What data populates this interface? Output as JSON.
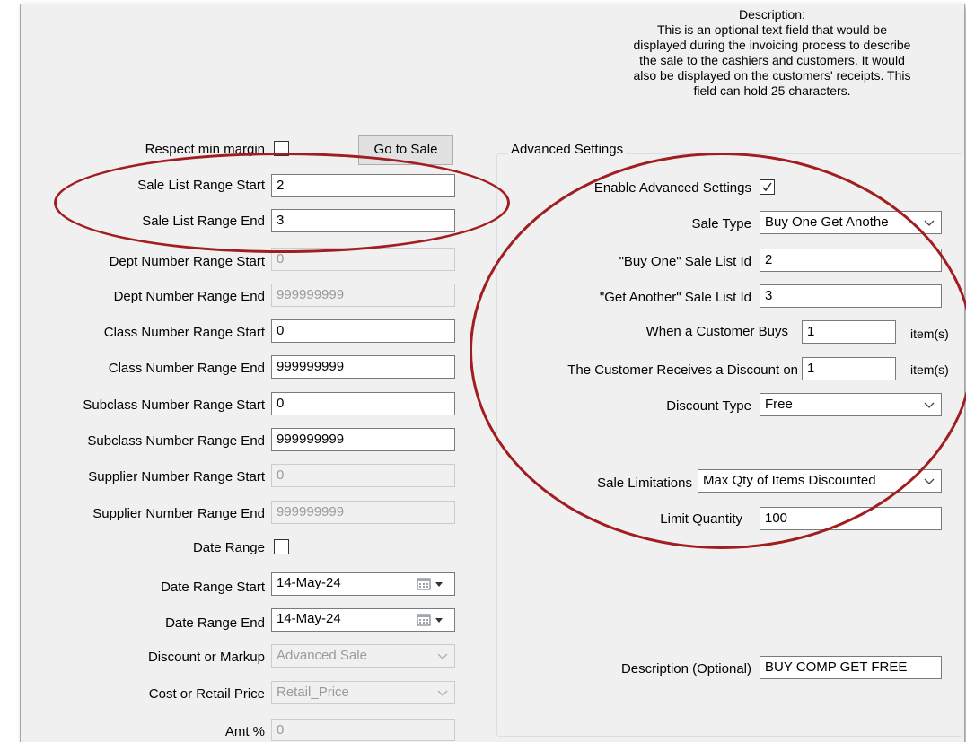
{
  "description_note": [
    "Description:",
    "This is an optional text field that would be",
    "displayed during the invoicing process to describe",
    "the sale to the cashiers and customers. It would",
    "also be displayed on the customers' receipts. This",
    "field can hold 25 characters."
  ],
  "left": {
    "respect_min_margin_label": "Respect min margin",
    "respect_min_margin_checked": false,
    "go_to_sale_label": "Go to Sale",
    "sale_list_range_start_label": "Sale List Range Start",
    "sale_list_range_start_value": "2",
    "sale_list_range_end_label": "Sale List Range End",
    "sale_list_range_end_value": "3",
    "dept_start_label": "Dept Number Range Start",
    "dept_start_value": "0",
    "dept_end_label": "Dept Number Range End",
    "dept_end_value": "999999999",
    "class_start_label": "Class Number Range Start",
    "class_start_value": "0",
    "class_end_label": "Class Number Range End",
    "class_end_value": "999999999",
    "subclass_start_label": "Subclass Number Range Start",
    "subclass_start_value": "0",
    "subclass_end_label": "Subclass Number Range End",
    "subclass_end_value": "999999999",
    "supplier_start_label": "Supplier Number Range Start",
    "supplier_start_value": "0",
    "supplier_end_label": "Supplier Number Range End",
    "supplier_end_value": "999999999",
    "date_range_label": "Date Range",
    "date_range_checked": false,
    "date_start_label": "Date Range Start",
    "date_start_value": "14-May-24",
    "date_end_label": "Date Range End",
    "date_end_value": "14-May-24",
    "discount_markup_label": "Discount or Markup",
    "discount_markup_value": "Advanced Sale",
    "cost_retail_label": "Cost or Retail Price",
    "cost_retail_value": "Retail_Price",
    "amt_label": "Amt %",
    "amt_value": "0"
  },
  "advanced": {
    "group_title": "Advanced Settings",
    "enable_label": "Enable Advanced Settings",
    "enable_checked": true,
    "sale_type_label": "Sale Type",
    "sale_type_value": "Buy One Get Anothe",
    "buy_one_label": "\"Buy One\" Sale List Id",
    "buy_one_value": "2",
    "get_another_label": "\"Get Another\" Sale List Id",
    "get_another_value": "3",
    "customer_buys_label": "When a Customer Buys",
    "customer_buys_value": "1",
    "items_unit_1": "item(s)",
    "receives_label": "The Customer Receives a Discount on",
    "receives_value": "1",
    "items_unit_2": "item(s)",
    "discount_type_label": "Discount Type",
    "discount_type_value": "Free",
    "sale_limitations_label": "Sale Limitations",
    "sale_limitations_value": "Max Qty of Items Discounted",
    "limit_quantity_label": "Limit Quantity",
    "limit_quantity_value": "100",
    "description_label": "Description (Optional)",
    "description_value": "BUY COMP GET FREE"
  },
  "colors": {
    "window_bg": "#f0f0f0",
    "annotation": "#a11d20",
    "disabled_text": "#9a9a9a"
  }
}
